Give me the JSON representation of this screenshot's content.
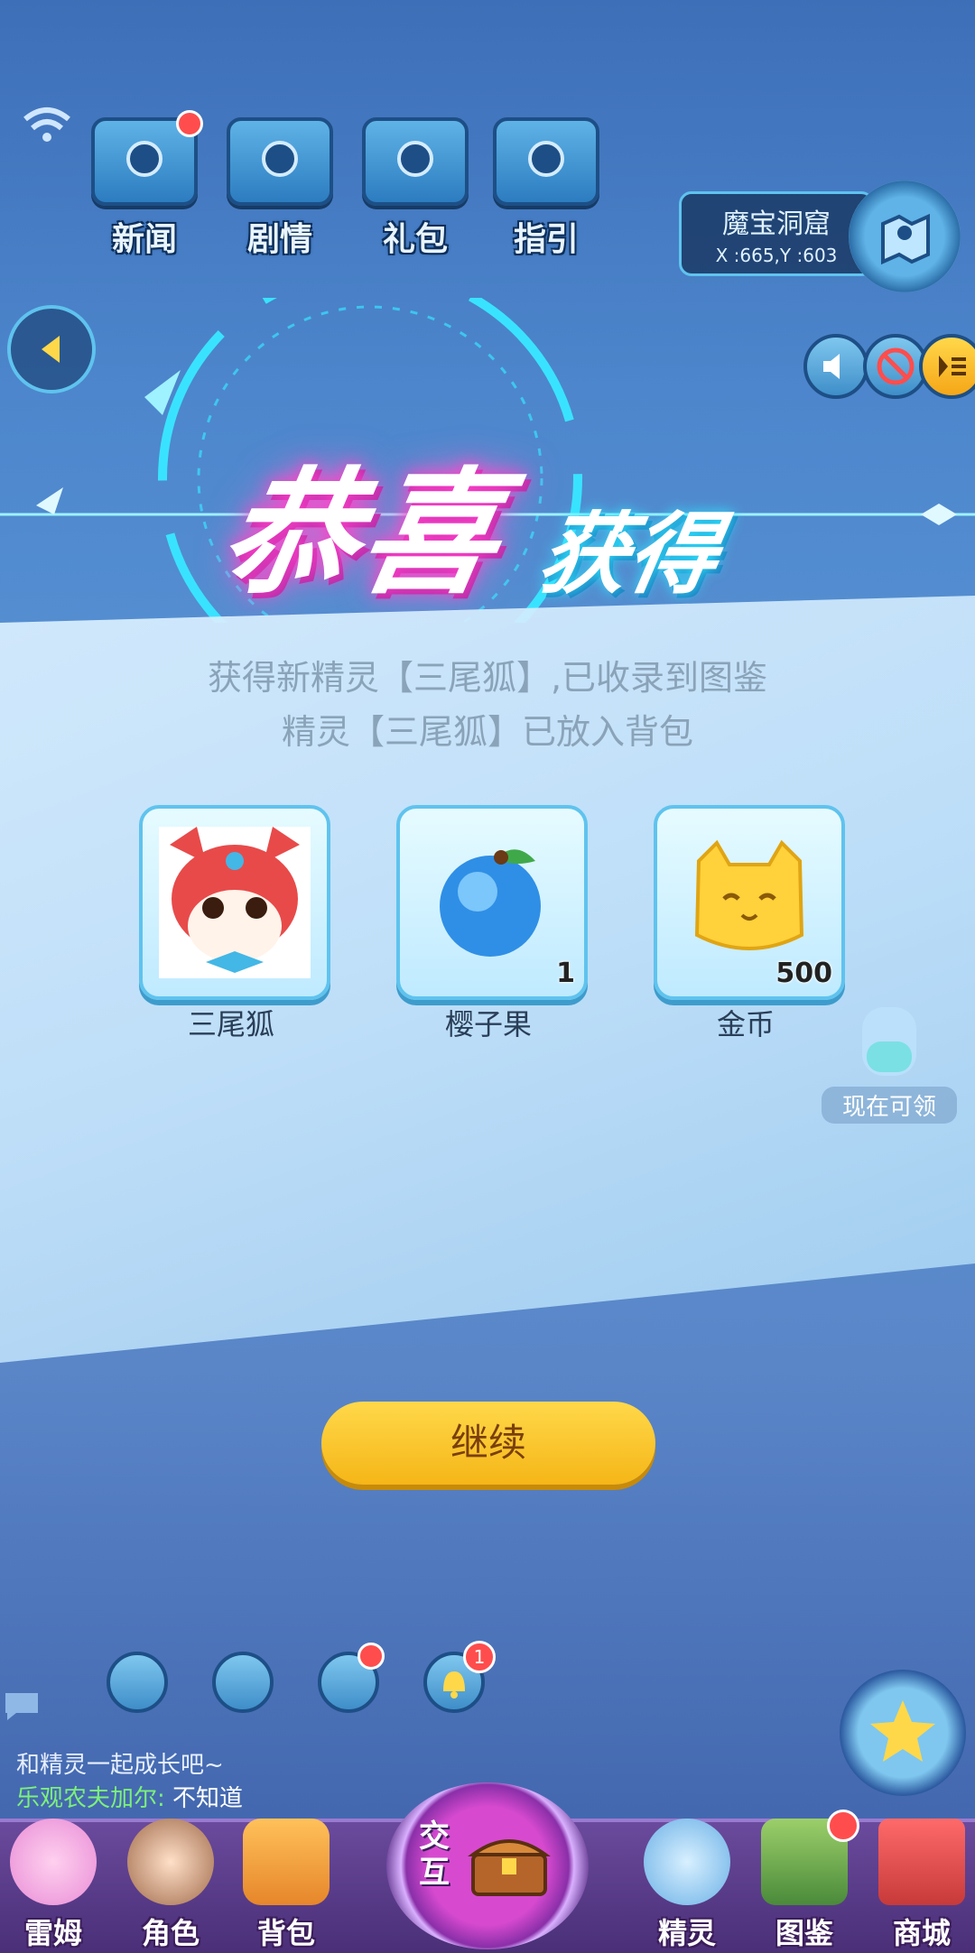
{
  "top_menu": [
    "新闻",
    "剧情",
    "礼包",
    "指引"
  ],
  "location": {
    "name": "魔宝洞窟",
    "coords": "X :665,Y :603"
  },
  "title": {
    "main": "恭喜",
    "sub": "获得"
  },
  "messages": [
    "获得新精灵【三尾狐】,已收录到图鉴",
    "精灵【三尾狐】已放入背包"
  ],
  "rewards": [
    {
      "name": "三尾狐",
      "qty": ""
    },
    {
      "name": "樱子果",
      "qty": "1"
    },
    {
      "name": "金币",
      "qty": "500"
    }
  ],
  "side_label": "现在可领",
  "continue_label": "继续",
  "chat": {
    "line1": "和精灵一起成长吧~",
    "speaker": "乐观农夫加尔:",
    "line2": "不知道"
  },
  "bottom_nav": [
    "雷姆",
    "角色",
    "背包",
    "交互",
    "精灵",
    "图鉴",
    "商城"
  ],
  "badges": {
    "bell": "1"
  }
}
